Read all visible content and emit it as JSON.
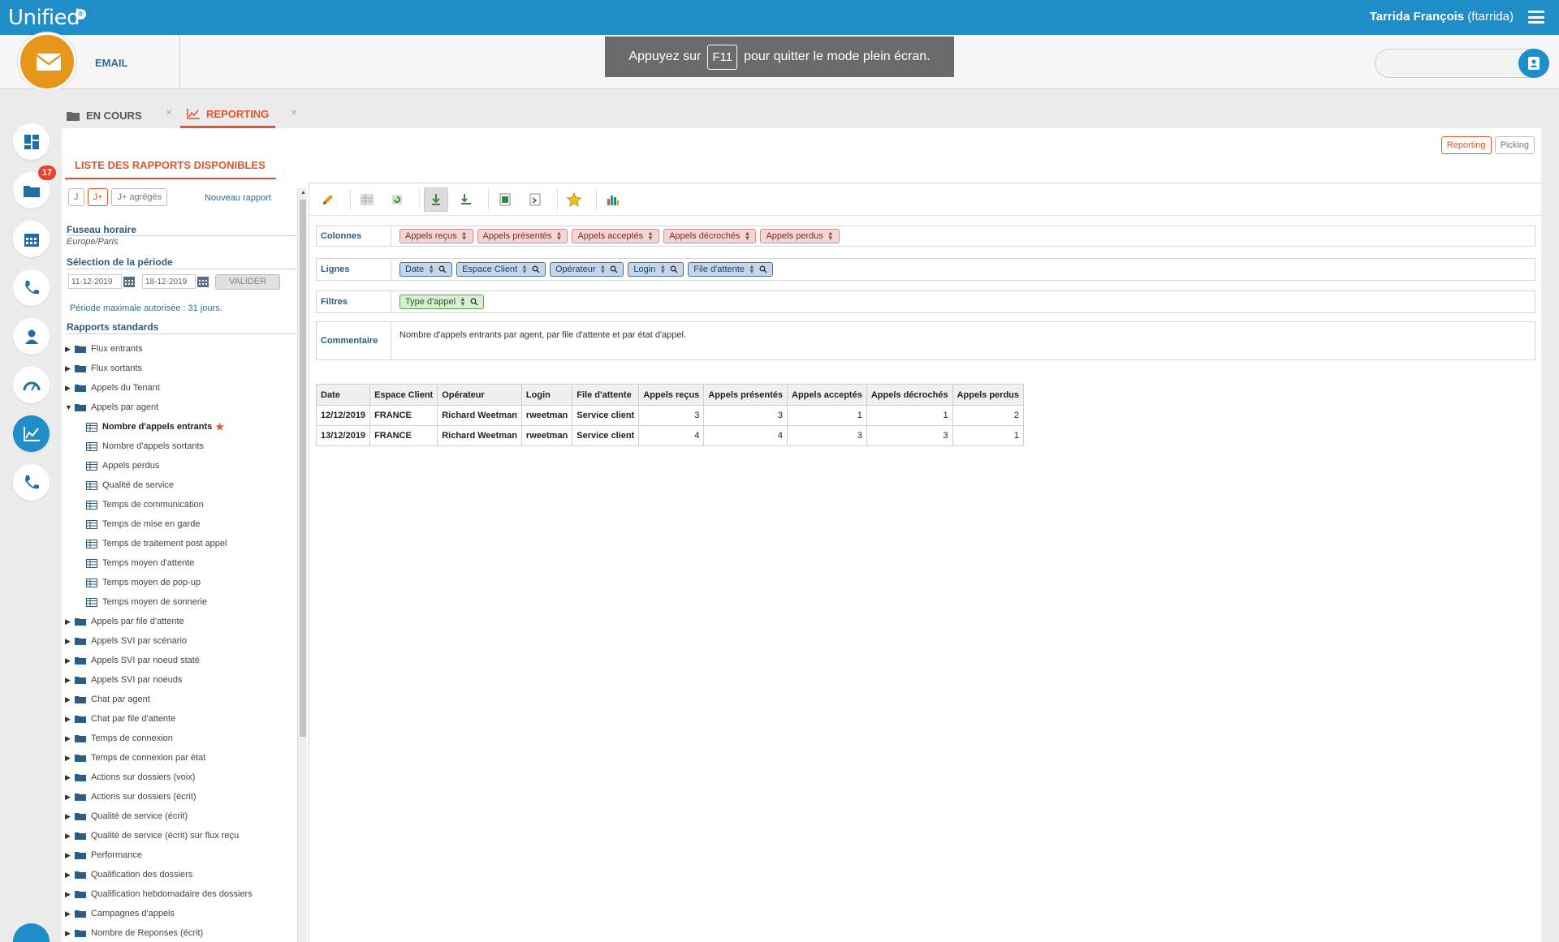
{
  "app": {
    "logo": "Unified",
    "logo_badge": "®",
    "user_name": "Tarrida François",
    "user_login": "(ftarrida)"
  },
  "channel": {
    "label": "EMAIL"
  },
  "fullscreen": {
    "prefix": "Appuyez sur",
    "key": "F11",
    "suffix": "pour quitter le mode plein écran."
  },
  "nav": {
    "folder_badge": "17"
  },
  "tabs": [
    {
      "label": "EN COURS"
    },
    {
      "label": "REPORTING"
    }
  ],
  "view_switch": {
    "reporting": "Reporting",
    "picking": "Picking"
  },
  "left": {
    "title": "LISTE DES RAPPORTS DISPONIBLES",
    "period_buttons": [
      "J",
      "J+",
      "J+ agrégés"
    ],
    "new_report": "Nouveau rapport",
    "timezone_label": "Fuseau horaire",
    "timezone_value": "Europe/Paris",
    "period_label": "Sélection de la période",
    "date_from": "11-12-2019",
    "date_to": "18-12-2019",
    "validate": "VALIDER",
    "period_max": "Période maximale autorisée : 31 jours.",
    "standards_label": "Rapports standards"
  },
  "tree": [
    {
      "label": "Flux entrants",
      "type": "folder",
      "open": false
    },
    {
      "label": "Flux sortants",
      "type": "folder",
      "open": false
    },
    {
      "label": "Appels du Tenant",
      "type": "folder",
      "open": false
    },
    {
      "label": "Appels par agent",
      "type": "folder",
      "open": true
    },
    {
      "label": "Nombre d'appels entrants",
      "type": "report",
      "selected": true
    },
    {
      "label": "Nombre d'appels sortants",
      "type": "report"
    },
    {
      "label": "Appels perdus",
      "type": "report"
    },
    {
      "label": "Qualité de service",
      "type": "report"
    },
    {
      "label": "Temps de communication",
      "type": "report"
    },
    {
      "label": "Temps de mise en garde",
      "type": "report"
    },
    {
      "label": "Temps de traitement post appel",
      "type": "report"
    },
    {
      "label": "Temps moyen d'attente",
      "type": "report"
    },
    {
      "label": "Temps moyen de pop-up",
      "type": "report"
    },
    {
      "label": "Temps moyen de sonnerie",
      "type": "report"
    },
    {
      "label": "Appels par file d'attente",
      "type": "folder",
      "open": false
    },
    {
      "label": "Appels SVI par scénario",
      "type": "folder",
      "open": false
    },
    {
      "label": "Appels SVI par noeud staté",
      "type": "folder",
      "open": false
    },
    {
      "label": "Appels SVI par noeuds",
      "type": "folder",
      "open": false
    },
    {
      "label": "Chat par agent",
      "type": "folder",
      "open": false
    },
    {
      "label": "Chat par file d'attente",
      "type": "folder",
      "open": false
    },
    {
      "label": "Temps de connexion",
      "type": "folder",
      "open": false
    },
    {
      "label": "Temps de connexion par état",
      "type": "folder",
      "open": false
    },
    {
      "label": "Actions sur dossiers (voix)",
      "type": "folder",
      "open": false
    },
    {
      "label": "Actions sur dossiers (écrit)",
      "type": "folder",
      "open": false
    },
    {
      "label": "Qualité de service (écrit)",
      "type": "folder",
      "open": false
    },
    {
      "label": "Qualité de service (écrit) sur flux reçu",
      "type": "folder",
      "open": false
    },
    {
      "label": "Performance",
      "type": "folder",
      "open": false
    },
    {
      "label": "Qualification des dossiers",
      "type": "folder",
      "open": false
    },
    {
      "label": "Qualification hebdomadaire des dossiers",
      "type": "folder",
      "open": false
    },
    {
      "label": "Campagnes d'appels",
      "type": "folder",
      "open": false
    },
    {
      "label": "Nombre de Reponses (écrit)",
      "type": "folder",
      "open": false
    }
  ],
  "dimensions": {
    "columns_label": "Colonnes",
    "columns": [
      "Appels reçus",
      "Appels présentés",
      "Appels acceptés",
      "Appels décrochés",
      "Appels perdus"
    ],
    "rows_label": "Lignes",
    "rows": [
      "Date",
      "Espace Client",
      "Opérateur",
      "Login",
      "File d'attente"
    ],
    "filters_label": "Filtres",
    "filters": [
      "Type d'appel"
    ],
    "comment_label": "Commentaire",
    "comment": "Nombre d'appels entrants par agent, par file d'attente et par état d'appel."
  },
  "table": {
    "headers": [
      "Date",
      "Espace Client",
      "Opérateur",
      "Login",
      "File d'attente",
      "Appels reçus",
      "Appels présentés",
      "Appels acceptés",
      "Appels décrochés",
      "Appels perdus"
    ],
    "rows": [
      [
        "12/12/2019",
        "FRANCE",
        "Richard Weetman",
        "rweetman",
        "Service client",
        "3",
        "3",
        "1",
        "1",
        "2"
      ],
      [
        "13/12/2019",
        "FRANCE",
        "Richard Weetman",
        "rweetman",
        "Service client",
        "4",
        "4",
        "3",
        "3",
        "1"
      ]
    ]
  }
}
